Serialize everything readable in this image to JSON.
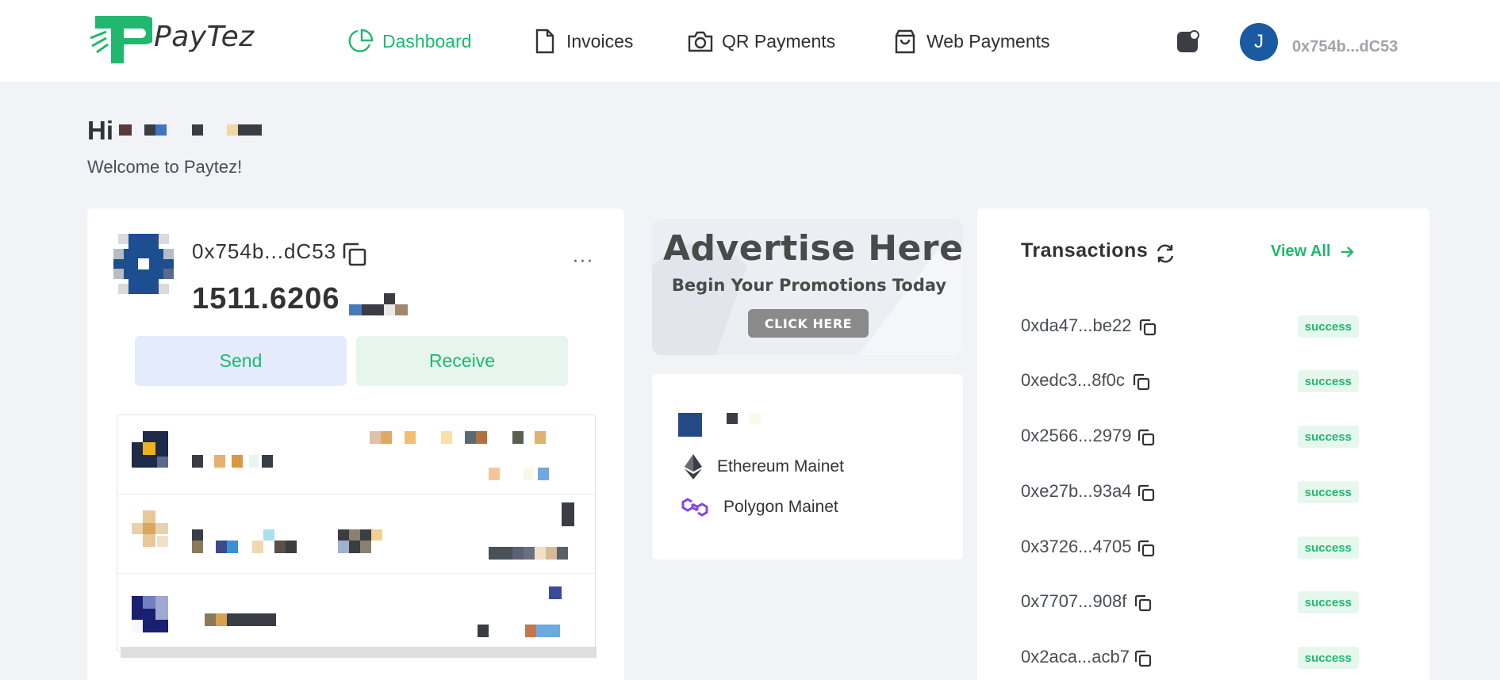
{
  "header": {
    "brand": "PayTez",
    "nav": [
      {
        "label": "Dashboard",
        "icon": "pie-chart-icon",
        "active": true
      },
      {
        "label": "Invoices",
        "icon": "file-icon",
        "active": false
      },
      {
        "label": "QR Payments",
        "icon": "camera-icon",
        "active": false
      },
      {
        "label": "Web Payments",
        "icon": "shopping-bag-icon",
        "active": false
      }
    ],
    "avatar_initial": "J",
    "address": "0x754b...dC53"
  },
  "greeting": {
    "hi": "Hi",
    "welcome": "Welcome to Paytez!"
  },
  "wallet": {
    "address": "0x754b...dC53",
    "balance": "1511.6206",
    "more": "···",
    "send_label": "Send",
    "receive_label": "Receive"
  },
  "ad": {
    "title": "Advertise Here",
    "subtitle": "Begin Your Promotions Today",
    "button": "CLICK HERE"
  },
  "networks": [
    {
      "label": "Ethereum Mainet",
      "icon": "ethereum-icon"
    },
    {
      "label": "Polygon Mainet",
      "icon": "polygon-icon"
    }
  ],
  "transactions": {
    "title": "Transactions",
    "view_all": "View All",
    "items": [
      {
        "hash": "0xda47...be22",
        "status": "success"
      },
      {
        "hash": "0xedc3...8f0c",
        "status": "success"
      },
      {
        "hash": "0x2566...2979",
        "status": "success"
      },
      {
        "hash": "0xe27b...93a4",
        "status": "success"
      },
      {
        "hash": "0x3726...4705",
        "status": "success"
      },
      {
        "hash": "0x7707...908f",
        "status": "success"
      },
      {
        "hash": "0x2aca...acb7",
        "status": "success"
      }
    ]
  },
  "colors": {
    "accent": "#1fb86e",
    "background": "#f2f3f7",
    "avatar": "#1a5aa0",
    "badge_bg": "#e6f7ee"
  }
}
